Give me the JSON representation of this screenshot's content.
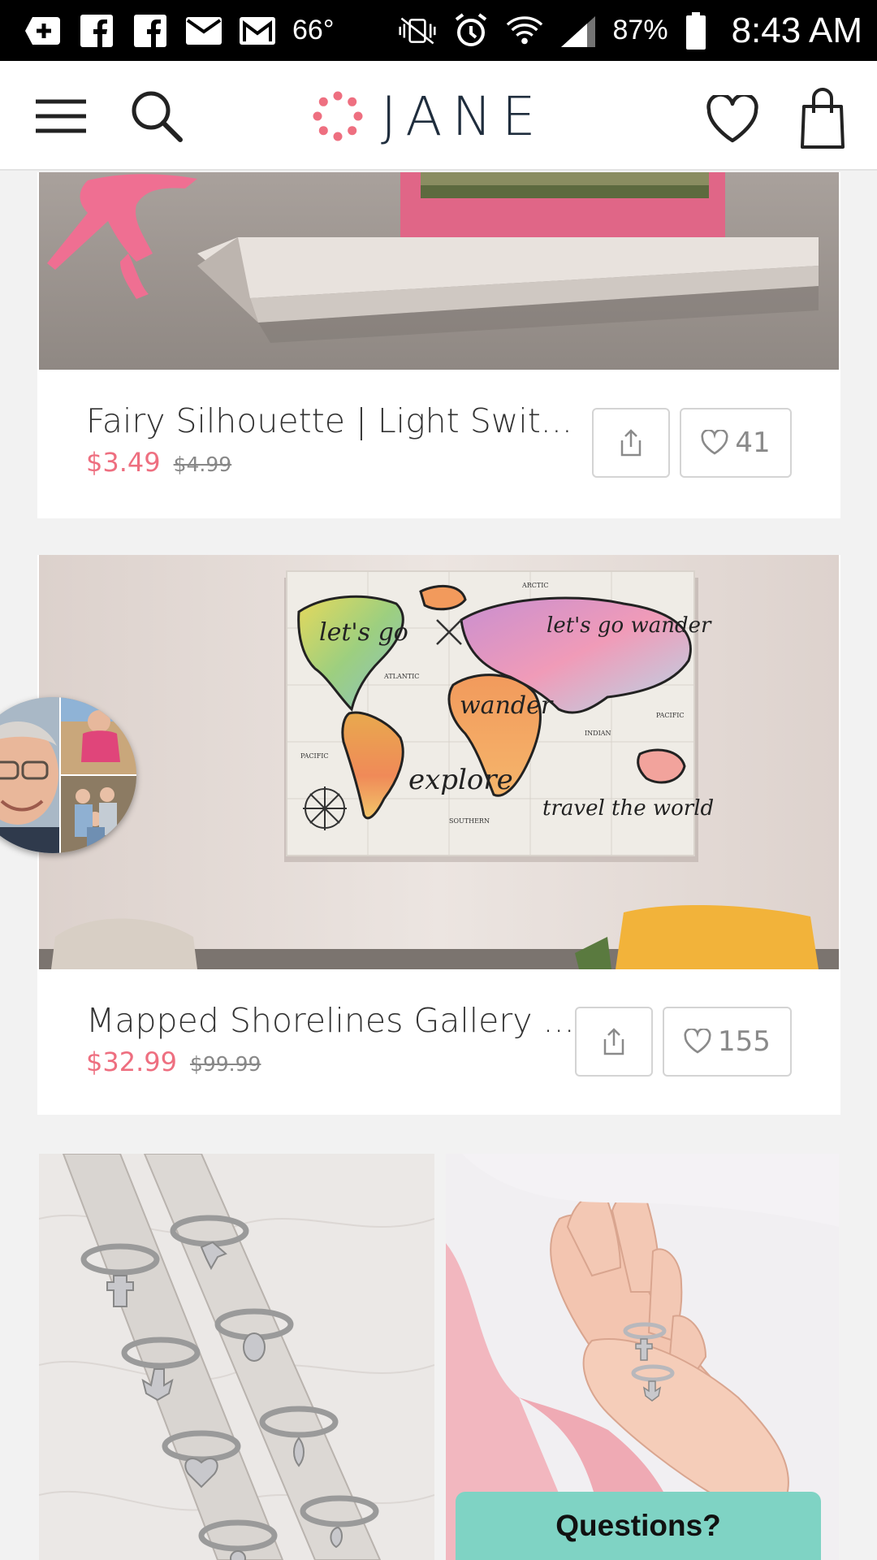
{
  "status_bar": {
    "temperature": "66°",
    "battery": "87%",
    "time": "8:43 AM"
  },
  "header": {
    "logo_text": "JANE",
    "accent_color": "#ee6f80"
  },
  "products": [
    {
      "title": "Fairy Silhouette | Light Swit...",
      "sale_price": "$3.49",
      "original_price": "$4.99",
      "likes": "41"
    },
    {
      "title": "Mapped Shorelines Gallery ...",
      "sale_price": "$32.99",
      "original_price": "$99.99",
      "likes": "155"
    }
  ],
  "map_art": {
    "labels": [
      "let's go",
      "let's go wander",
      "wander",
      "explore",
      "travel the world"
    ],
    "ocean_labels": [
      "ARCTIC",
      "ATLANTIC",
      "PACIFIC",
      "INDIAN",
      "PACIFIC",
      "SOUTHERN"
    ]
  },
  "questions_button": "Questions?"
}
